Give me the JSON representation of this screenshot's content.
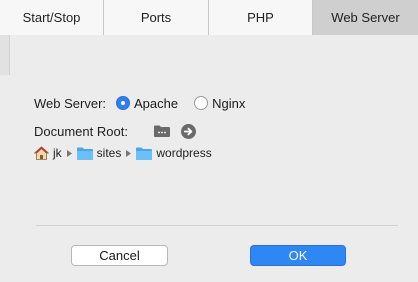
{
  "tabs": [
    {
      "label": "Start/Stop",
      "active": false
    },
    {
      "label": "Ports",
      "active": false
    },
    {
      "label": "PHP",
      "active": false
    },
    {
      "label": "Web Server",
      "active": true
    }
  ],
  "web_server": {
    "label": "Web Server:",
    "options": [
      {
        "label": "Apache",
        "selected": true
      },
      {
        "label": "Nginx",
        "selected": false
      }
    ]
  },
  "document_root": {
    "label": "Document Root:",
    "path": [
      "jk",
      "sites",
      "wordpress"
    ]
  },
  "buttons": {
    "cancel": "Cancel",
    "ok": "OK"
  },
  "colors": {
    "accent": "#2f86f5",
    "folder": "#5ab4f0",
    "active_tab": "#cfcfcf"
  },
  "icons": {
    "browse_folder": "folder-icon",
    "reveal": "arrow-right-circle-icon",
    "home": "home-icon",
    "path_folder": "folder-icon"
  }
}
